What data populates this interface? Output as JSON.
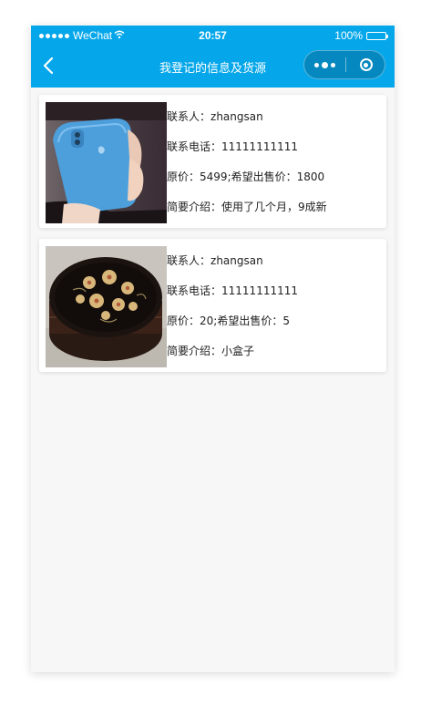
{
  "status_bar": {
    "carrier": "WeChat",
    "time": "20:57",
    "battery": "100%",
    "battery_level": 1.0
  },
  "nav": {
    "title": "我登记的信息及货源"
  },
  "items": [
    {
      "contact_label": "联系人：",
      "contact": "zhangsan",
      "phone_label": "联系电话：",
      "phone": "11111111111",
      "price_label": "原价：",
      "price": "5499",
      "sep": ";",
      "sale_label": "希望出售价：",
      "sale_price": "1800",
      "desc_label": "简要介绍：",
      "desc": "使用了几个月，9成新",
      "image_icon": "iphone-photo"
    },
    {
      "contact_label": "联系人：",
      "contact": "zhangsan",
      "phone_label": "联系电话：",
      "phone": "11111111111",
      "price_label": "原价：",
      "price": "20",
      "sep": ";",
      "sale_label": "希望出售价：",
      "sale_price": "5",
      "desc_label": "简要介绍：",
      "desc": "小盒子",
      "image_icon": "lacquer-box-photo"
    }
  ],
  "colors": {
    "nav_background": "#06a7ea",
    "page_background": "#f7f7f7"
  }
}
